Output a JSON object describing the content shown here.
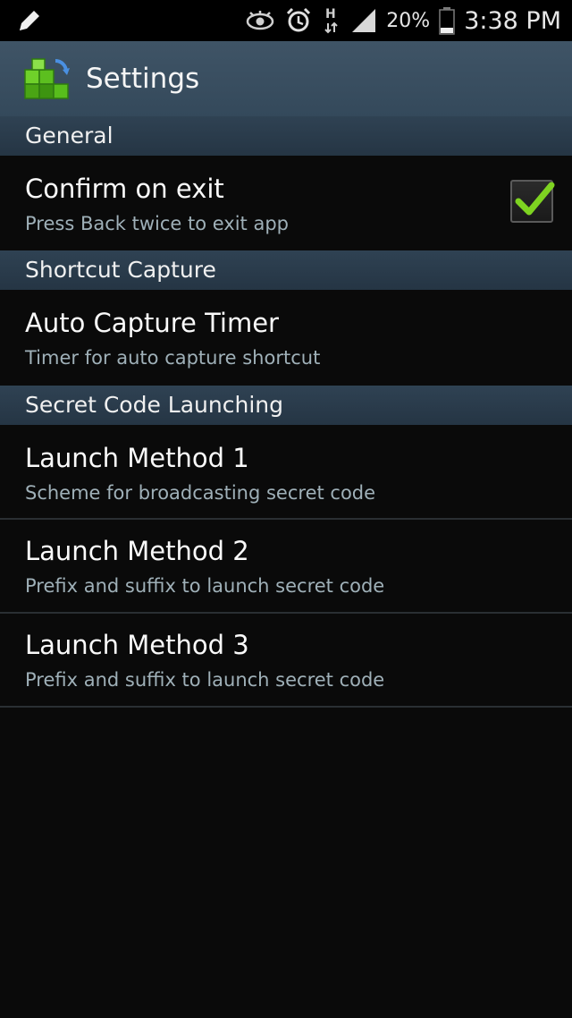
{
  "status_bar": {
    "icons": [
      "pencil-icon",
      "eye-icon",
      "alarm-icon",
      "hsdpa-icon",
      "signal-icon",
      "battery-icon"
    ],
    "network_label": "H",
    "battery_percent": "20%",
    "time": "3:38 PM"
  },
  "action_bar": {
    "title": "Settings",
    "icon": "cube-refresh-icon"
  },
  "categories": [
    {
      "label": "General"
    },
    {
      "label": "Shortcut Capture"
    },
    {
      "label": "Secret Code Launching"
    }
  ],
  "preferences": [
    {
      "title": "Confirm on exit",
      "summary": "Press Back twice to exit app",
      "checked": true
    },
    {
      "title": "Auto Capture Timer",
      "summary": "Timer for auto capture shortcut"
    },
    {
      "title": "Launch Method 1",
      "summary": "Scheme for broadcasting secret code"
    },
    {
      "title": "Launch Method 2",
      "summary": "Prefix and suffix to launch secret code"
    },
    {
      "title": "Launch Method 3",
      "summary": "Prefix and suffix to launch secret code"
    }
  ],
  "colors": {
    "action_bar": "#3a4f61",
    "category_bg": "#2b3d4d",
    "checkmark": "#7ed321",
    "background": "#0a0a0a"
  }
}
